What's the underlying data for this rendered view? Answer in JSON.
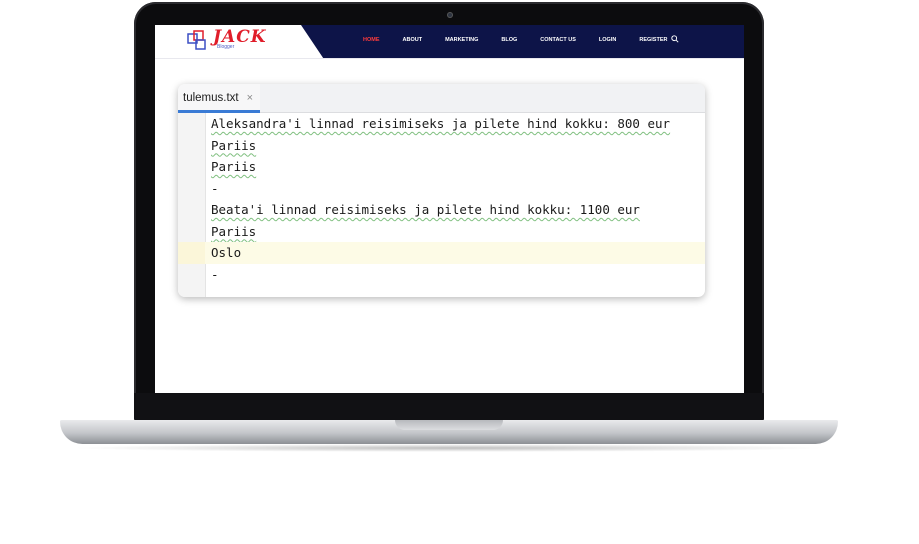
{
  "site": {
    "logo_text": "JACK",
    "logo_sub": "Blogger",
    "nav": [
      {
        "label": "HOME",
        "active": true
      },
      {
        "label": "ABOUT",
        "active": false
      },
      {
        "label": "MARKETING",
        "active": false
      },
      {
        "label": "BLOG",
        "active": false
      },
      {
        "label": "CONTACT US",
        "active": false
      },
      {
        "label": "LOGIN",
        "active": false
      },
      {
        "label": "REGISTER",
        "active": false
      }
    ],
    "search_icon": "search-icon",
    "colors": {
      "nav_bg": "#0d1448",
      "active": "#ff3b3b",
      "logo": "#e01d2a"
    }
  },
  "editor": {
    "tab_label": "tulemus.txt",
    "tab_close": "×",
    "current_line": 7,
    "lines": [
      "Aleksandra'i linnad reisimiseks ja pilete hind kokku: 800 eur",
      "Pariis",
      "Pariis",
      "-",
      "Beata'i linnad reisimiseks ja pilete hind kokku: 1100 eur",
      "Pariis",
      "Oslo",
      "-"
    ]
  }
}
